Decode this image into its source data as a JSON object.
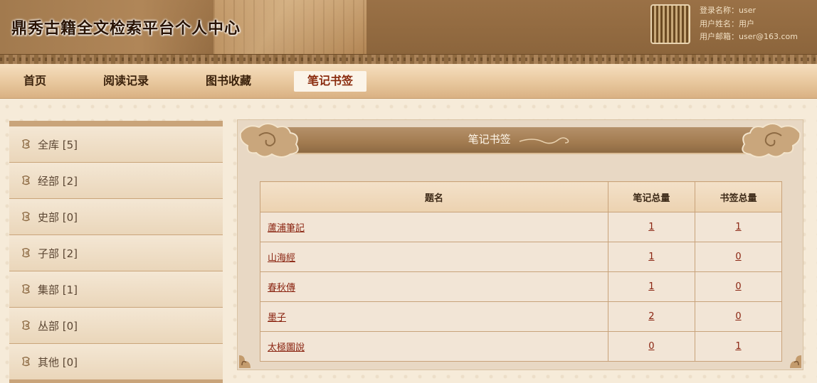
{
  "header": {
    "site_title": "鼎秀古籍全文检索平台个人中心",
    "user": {
      "login_name": "登录名称：user",
      "user_name": "用户姓名：用户",
      "user_email": "用户邮箱：user@163.com"
    }
  },
  "nav": {
    "items": [
      {
        "label": "首页"
      },
      {
        "label": "阅读记录"
      },
      {
        "label": "图书收藏"
      },
      {
        "label": "笔记书签"
      }
    ],
    "active_index": 3
  },
  "sidebar": {
    "items": [
      {
        "label": "全库 [5]"
      },
      {
        "label": "经部 [2]"
      },
      {
        "label": "史部 [0]"
      },
      {
        "label": "子部 [2]"
      },
      {
        "label": "集部 [1]"
      },
      {
        "label": "丛部 [0]"
      },
      {
        "label": "其他 [0]"
      }
    ]
  },
  "panel": {
    "title": "笔记书签",
    "table": {
      "headers": [
        "题名",
        "笔记总量",
        "书签总量"
      ],
      "rows": [
        {
          "title": "蘆浦筆記",
          "notes": "1",
          "bookmarks": "1"
        },
        {
          "title": "山海經",
          "notes": "1",
          "bookmarks": "0"
        },
        {
          "title": "春秋傳",
          "notes": "1",
          "bookmarks": "0"
        },
        {
          "title": "墨子",
          "notes": "2",
          "bookmarks": "0"
        },
        {
          "title": "太極圖說",
          "notes": "0",
          "bookmarks": "1"
        }
      ]
    }
  },
  "colors": {
    "header_bg": "#9a7146",
    "nav_active_text": "#8a2b0e",
    "link_text": "#8a2411",
    "panel_bg": "#e8d8c4"
  }
}
